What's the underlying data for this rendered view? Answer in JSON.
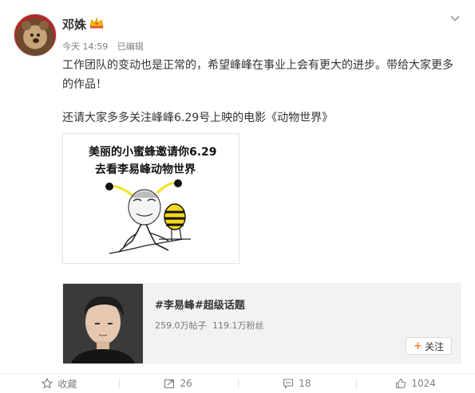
{
  "post": {
    "username": "邓姝",
    "vip_badge_icon": "vip-crown-icon",
    "time": "今天 14:59",
    "edited": "已编辑",
    "text_line1": "工作团队的变动也是正常的，希望峰峰在事业上会有更大的进步。带给大家更多的作品！",
    "text_line2": "还请大家多多关注峰峰6.29号上映的电影《动物世界》",
    "menu_icon": "chevron-down-icon"
  },
  "meme": {
    "caption_line1": "美丽的小蜜蜂邀请你6.29",
    "caption_line2": "去看李易峰动物世界"
  },
  "card": {
    "title": "#李易峰#超级话题",
    "posts": "259.0万帖子",
    "fans": "119.1万粉丝",
    "follow_label": "关注"
  },
  "actions": {
    "favorite_label": "收藏",
    "repost_count": "26",
    "comment_count": "18",
    "like_count": "1024"
  },
  "colors": {
    "accent": "#ff8140",
    "text": "#333333",
    "muted": "#808080"
  }
}
